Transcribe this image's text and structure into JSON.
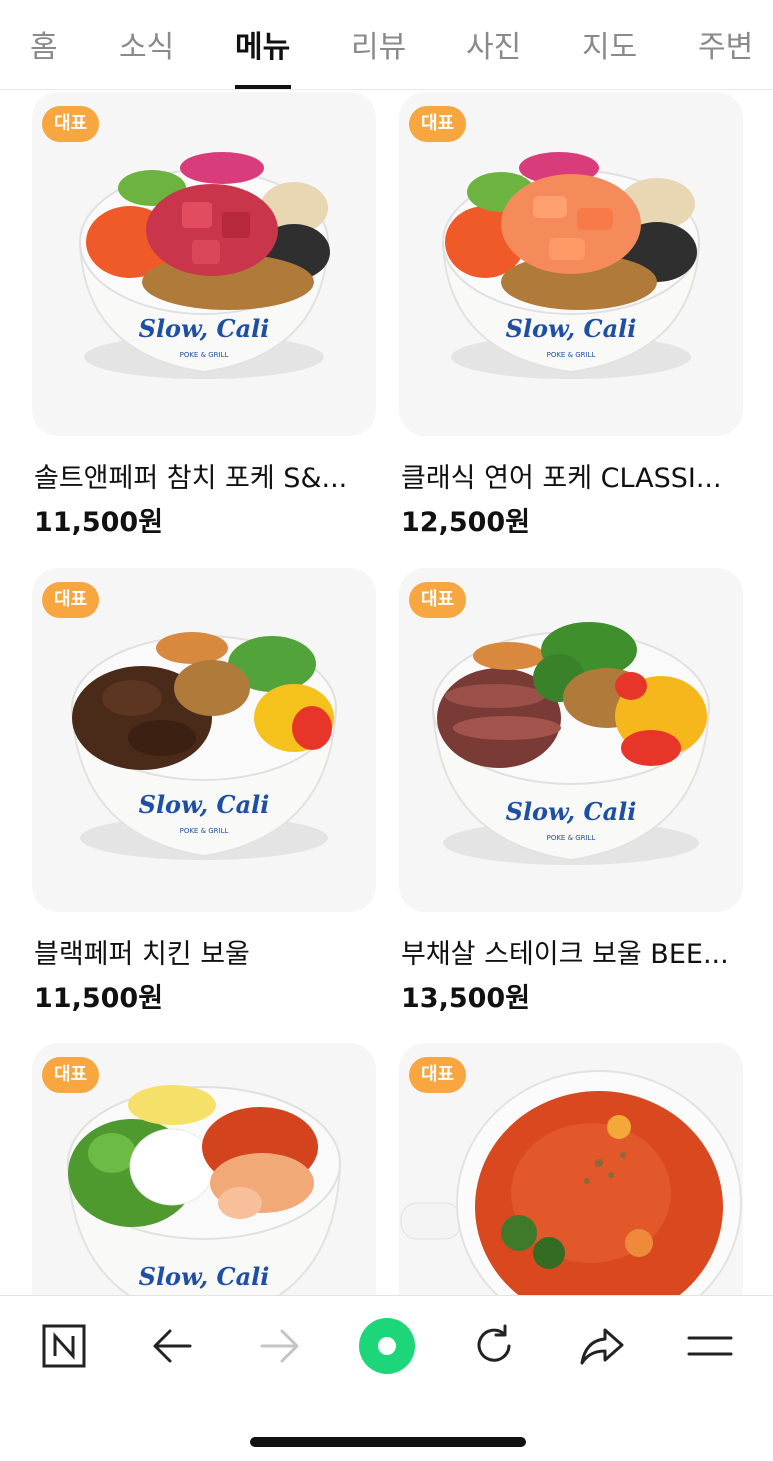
{
  "tabs": [
    {
      "label": "홈",
      "active": false
    },
    {
      "label": "소식",
      "active": false
    },
    {
      "label": "메뉴",
      "active": true
    },
    {
      "label": "리뷰",
      "active": false
    },
    {
      "label": "사진",
      "active": false
    },
    {
      "label": "지도",
      "active": false
    },
    {
      "label": "주변",
      "active": false
    }
  ],
  "menu": {
    "items": [
      {
        "badge": "대표",
        "name": "솔트앤페퍼 참치 포케 S&...",
        "price": "11,500원",
        "brand": "Slow, Cali",
        "brand_sub": "POKE & GRILL",
        "image": "tuna-poke-bowl"
      },
      {
        "badge": "대표",
        "name": "클래식 연어 포케 CLASSI...",
        "price": "12,500원",
        "brand": "Slow, Cali",
        "brand_sub": "POKE & GRILL",
        "image": "salmon-poke-bowl"
      },
      {
        "badge": "대표",
        "name": "블랙페퍼 치킨 보울",
        "price": "11,500원",
        "brand": "Slow, Cali",
        "brand_sub": "POKE & GRILL",
        "image": "chicken-bowl"
      },
      {
        "badge": "대표",
        "name": "부채살 스테이크 보울 BEE...",
        "price": "13,500원",
        "brand": "Slow, Cali",
        "brand_sub": "POKE & GRILL",
        "image": "steak-bowl"
      },
      {
        "badge": "대표",
        "name": "",
        "price": "",
        "brand": "Slow, Cali",
        "brand_sub": "",
        "image": "shrimp-salad-bowl"
      },
      {
        "badge": "대표",
        "name": "",
        "price": "",
        "brand": "",
        "brand_sub": "",
        "image": "tomato-soup"
      }
    ]
  },
  "toolbar": {
    "icons": [
      "naver-n-icon",
      "back-arrow-icon",
      "forward-arrow-icon",
      "green-dot-home-icon",
      "refresh-icon",
      "share-icon",
      "menu-icon"
    ]
  },
  "colors": {
    "badge": "#f7a640",
    "brand": "#1e4fa3",
    "green": "#1ed67a",
    "tab_active": "#111111",
    "tab_inactive": "#8a8a8a"
  }
}
